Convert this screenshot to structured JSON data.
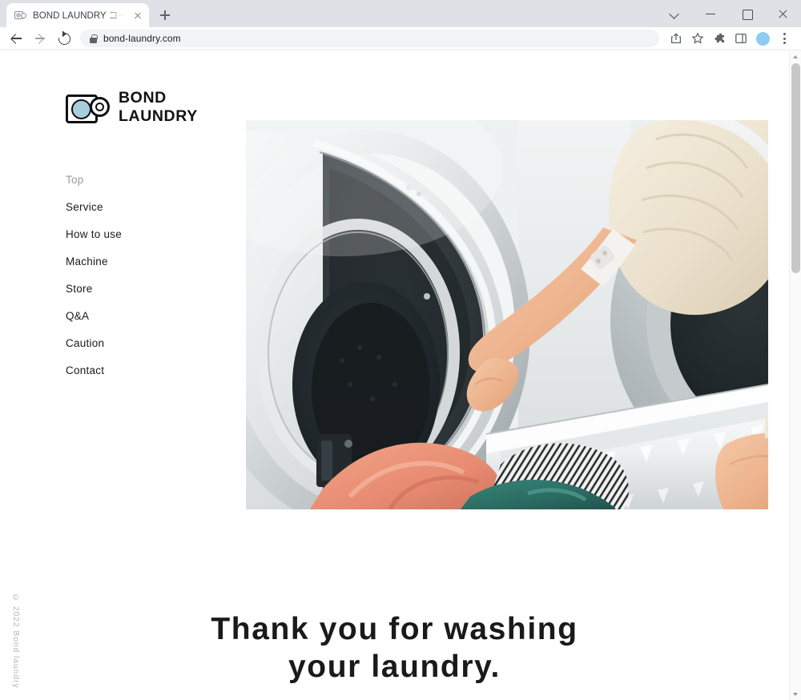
{
  "browser": {
    "tab": {
      "title": "BOND LAUNDRY コインランドリー 宮",
      "favicon": "washing-machine-favicon",
      "close_label": "×"
    },
    "new_tab_label": "+",
    "window_controls": {
      "tab_search": "tab-search-chevron",
      "minimize": "minimize",
      "maximize": "maximize",
      "close": "close"
    },
    "toolbar": {
      "back": "back-arrow",
      "forward": "forward-arrow",
      "reload": "reload",
      "url": "bond-laundry.com",
      "security": "lock-icon",
      "share": "share-icon",
      "bookmark": "star-icon",
      "extensions": "puzzle-icon",
      "side_panel": "side-panel-icon",
      "profile": "avatar",
      "menu": "three-dot-menu"
    }
  },
  "site": {
    "logo": {
      "line1": "BOND",
      "line2": "LAUNDRY",
      "mark_color": "#a8cede"
    },
    "nav": [
      {
        "label": "Top",
        "active": true
      },
      {
        "label": "Service",
        "active": false
      },
      {
        "label": "How to use",
        "active": false
      },
      {
        "label": "Machine",
        "active": false
      },
      {
        "label": "Store",
        "active": false
      },
      {
        "label": "Q&A",
        "active": false
      },
      {
        "label": "Caution",
        "active": false
      },
      {
        "label": "Contact",
        "active": false
      }
    ],
    "hero": {
      "alt": "Person in cream sweater loading striped and teal laundry from a white basket into an open front-load washing machine at a laundromat"
    },
    "headline_line1": "Thank you for washing",
    "headline_line2": "your laundry.",
    "copyright": "© 2022 Bond laundry"
  }
}
